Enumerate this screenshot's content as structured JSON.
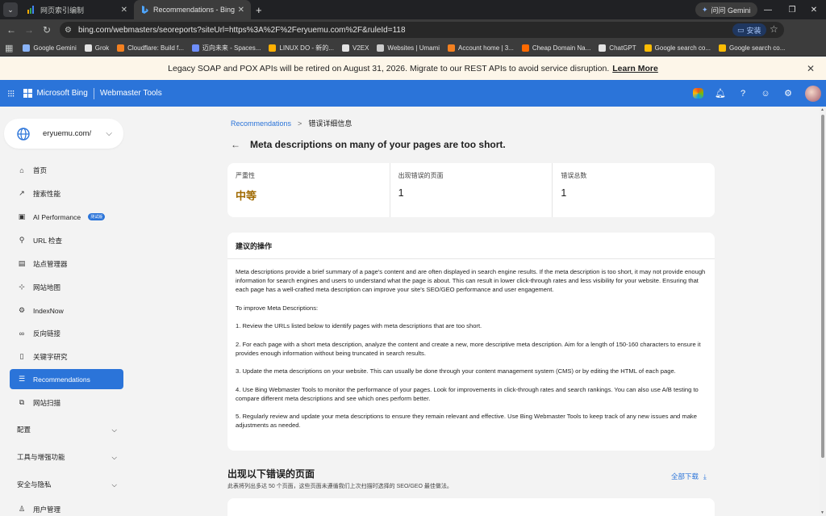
{
  "browser": {
    "tabs": [
      {
        "title": "网页索引编制",
        "active": false
      },
      {
        "title": "Recommendations - Bing We",
        "active": true
      }
    ],
    "gemini_label": "问问 Gemini",
    "url": "bing.com/webmasters/seoreports?siteUrl=https%3A%2F%2Feryuemu.com%2F&ruleId=118",
    "install_label": "安装",
    "bookmarks": [
      {
        "label": "Google Gemini",
        "color": "#8ab4f8"
      },
      {
        "label": "Grok",
        "color": "#e3e3e3"
      },
      {
        "label": "Cloudflare: Build f...",
        "color": "#f38020"
      },
      {
        "label": "迈向未来 - Spaces...",
        "color": "#6e8efb"
      },
      {
        "label": "LINUX DO - 新的...",
        "color": "#ffb003"
      },
      {
        "label": "V2EX",
        "color": "#e3e3e3"
      },
      {
        "label": "Websites | Umami",
        "color": "#cccccc"
      },
      {
        "label": "Account home | 3...",
        "color": "#f38020"
      },
      {
        "label": "Cheap Domain Na...",
        "color": "#ff6a00"
      },
      {
        "label": "ChatGPT",
        "color": "#e3e3e3"
      },
      {
        "label": "Google search co...",
        "color": "#fbbc04"
      },
      {
        "label": "Google search co...",
        "color": "#fbbc04"
      }
    ]
  },
  "banner": {
    "text": "Legacy SOAP and POX APIs will be retired on August 31, 2026. Migrate to our REST APIs to avoid service disruption.",
    "link": "Learn More"
  },
  "header": {
    "brand": "Microsoft Bing",
    "product": "Webmaster Tools"
  },
  "sidebar": {
    "site": "eryuemu.com/",
    "items": [
      {
        "label": "首页",
        "icon": "home-icon"
      },
      {
        "label": "搜索性能",
        "icon": "trend-icon"
      },
      {
        "label": "AI Performance",
        "icon": "ai-icon",
        "badge": "测试版"
      },
      {
        "label": "URL 检查",
        "icon": "search-icon"
      },
      {
        "label": "站点管理器",
        "icon": "sitemanager-icon"
      },
      {
        "label": "网站地图",
        "icon": "sitemap-icon"
      },
      {
        "label": "IndexNow",
        "icon": "indexnow-icon"
      },
      {
        "label": "反向链接",
        "icon": "link-icon"
      },
      {
        "label": "关键字研究",
        "icon": "keyword-icon"
      },
      {
        "label": "Recommendations",
        "icon": "recommend-icon",
        "active": true
      },
      {
        "label": "网站扫描",
        "icon": "scan-icon"
      }
    ],
    "groups": [
      "配置",
      "工具与增强功能",
      "安全与隐私"
    ],
    "bottom_item": "用户管理"
  },
  "main": {
    "breadcrumb_parent": "Recommendations",
    "breadcrumb_current": "错误详细信息",
    "title": "Meta descriptions on many of your pages are too short.",
    "stats": [
      {
        "label": "严重性",
        "value": "中等"
      },
      {
        "label": "出现错误的页面",
        "value": "1"
      },
      {
        "label": "错误总数",
        "value": "1"
      }
    ],
    "action_title": "建议的操作",
    "paragraphs": [
      "Meta descriptions provide a brief summary of a page's content and are often displayed in search engine results. If the meta description is too short, it may not provide enough information for search engines and users to understand what the page is about. This can result in lower click-through rates and less visibility for your website. Ensuring that each page has a well-crafted meta description can improve your site's SEO/GEO performance and user engagement.",
      "To improve Meta Descriptions:",
      "1. Review the URLs listed below to identify pages with meta descriptions that are too short.",
      "2. For each page with a short meta description, analyze the content and create a new, more descriptive meta description. Aim for a length of 150-160 characters to ensure it provides enough information without being truncated in search results.",
      "3. Update the meta descriptions on your website. This can usually be done through your content management system (CMS) or by editing the HTML of each page.",
      "4. Use Bing Webmaster Tools to monitor the performance of your pages. Look for improvements in click-through rates and search rankings. You can also use A/B testing to compare different meta descriptions and see which ones perform better.",
      "5. Regularly review and update your meta descriptions to ensure they remain relevant and effective. Use Bing Webmaster Tools to keep track of any new issues and make adjustments as needed."
    ],
    "pages_title": "出现以下错误的页面",
    "pages_subtitle": "此表将列出多达 50 个页面，这些页面未遵循我们上次扫描时选择的 SEO/GEO 最佳做法。",
    "download_label": "全部下载"
  },
  "colors": {
    "accent": "#2b74d9",
    "medium_severity": "#a06a00",
    "banner_bg": "#fdf6e9"
  }
}
